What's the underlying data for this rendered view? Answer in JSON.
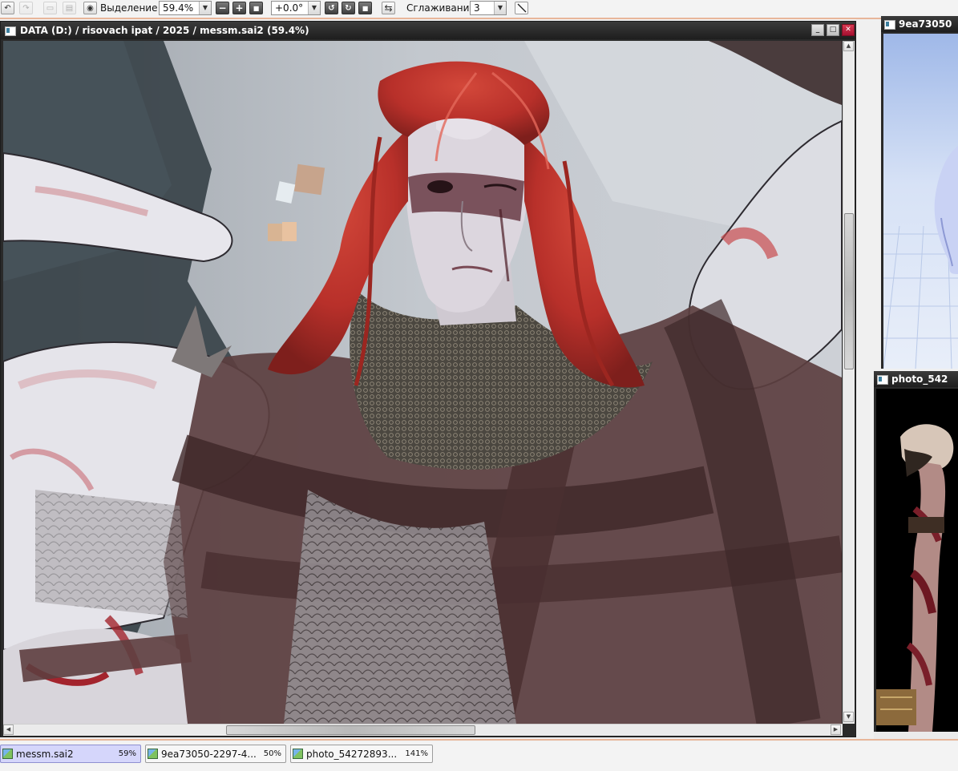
{
  "toolbar": {
    "undo_icon": "undo-icon",
    "redo_icon": "redo-icon",
    "selection_label": "Выделение",
    "zoom_value": "59.4%",
    "rotation_value": "+0.0°",
    "smoothing_label": "Сглаживание",
    "smoothing_value": "3"
  },
  "document": {
    "title": "DATA (D:) / risovach ipat / 2025 / messm.sai2 (59.4%)",
    "minimize_label": "_",
    "maximize_label": "□",
    "close_label": "✕"
  },
  "ref_panels": [
    {
      "title": "9ea73050"
    },
    {
      "title": "photo_542"
    }
  ],
  "file_tabs": [
    {
      "name": "messm.sai2",
      "zoom": "59%",
      "active": true
    },
    {
      "name": "9ea73050-2297-4...",
      "zoom": "50%",
      "active": false
    },
    {
      "name": "photo_54272893...",
      "zoom": "141%",
      "active": false
    }
  ],
  "colors": {
    "accent_line": "#e8b69a",
    "titlebar": "#2a2a2a",
    "active_tab": "#d5d6fb",
    "close_button": "#c01c3a"
  }
}
